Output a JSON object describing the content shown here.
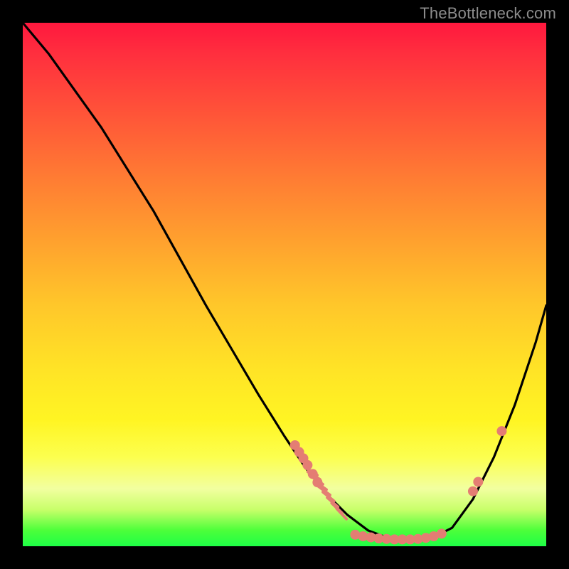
{
  "watermark": "TheBottleneck.com",
  "chart_data": {
    "type": "line",
    "title": "",
    "xlabel": "",
    "ylabel": "",
    "xlim": [
      0,
      100
    ],
    "ylim": [
      0,
      100
    ],
    "grid": false,
    "series": [
      {
        "name": "curve",
        "x": [
          0,
          5,
          10,
          15,
          20,
          25,
          30,
          35,
          40,
          45,
          50,
          54,
          58,
          62,
          66,
          70,
          74,
          78,
          82,
          86,
          90,
          94,
          98,
          100
        ],
        "y": [
          100,
          94,
          87,
          80,
          72,
          64,
          55,
          46,
          37.5,
          29,
          21,
          15,
          10,
          6,
          3,
          1.5,
          1,
          1.5,
          3.5,
          9,
          17,
          27,
          39,
          46
        ]
      }
    ],
    "markers": [
      {
        "kind": "dot",
        "x": 52.0,
        "y": 19.3
      },
      {
        "kind": "dot",
        "x": 52.8,
        "y": 18.0
      },
      {
        "kind": "dot",
        "x": 53.6,
        "y": 16.8
      },
      {
        "kind": "dot",
        "x": 54.4,
        "y": 15.5
      },
      {
        "kind": "dot",
        "x": 55.4,
        "y": 13.8
      },
      {
        "kind": "dot",
        "x": 56.3,
        "y": 12.2
      },
      {
        "kind": "dot",
        "x": 63.5,
        "y": 2.2
      },
      {
        "kind": "dot",
        "x": 65.0,
        "y": 1.9
      },
      {
        "kind": "dot",
        "x": 66.5,
        "y": 1.7
      },
      {
        "kind": "dot",
        "x": 68.0,
        "y": 1.5
      },
      {
        "kind": "dot",
        "x": 69.5,
        "y": 1.4
      },
      {
        "kind": "dot",
        "x": 71.0,
        "y": 1.3
      },
      {
        "kind": "dot",
        "x": 72.5,
        "y": 1.3
      },
      {
        "kind": "dot",
        "x": 74.0,
        "y": 1.3
      },
      {
        "kind": "dot",
        "x": 75.5,
        "y": 1.4
      },
      {
        "kind": "dot",
        "x": 77.0,
        "y": 1.6
      },
      {
        "kind": "dot",
        "x": 78.5,
        "y": 1.9
      },
      {
        "kind": "dot",
        "x": 80.0,
        "y": 2.4
      },
      {
        "kind": "dot",
        "x": 86.0,
        "y": 10.5
      },
      {
        "kind": "dot",
        "x": 87.0,
        "y": 12.3
      },
      {
        "kind": "dot",
        "x": 91.5,
        "y": 22.0
      },
      {
        "kind": "tick",
        "x": 55.1,
        "y": 14.3,
        "angle": -58
      },
      {
        "kind": "tick",
        "x": 55.6,
        "y": 13.5,
        "angle": -58
      },
      {
        "kind": "tick",
        "x": 56.2,
        "y": 12.6,
        "angle": -56
      },
      {
        "kind": "tick",
        "x": 56.9,
        "y": 11.6,
        "angle": -55
      },
      {
        "kind": "tick",
        "x": 57.6,
        "y": 10.6,
        "angle": -53
      },
      {
        "kind": "tick",
        "x": 58.4,
        "y": 9.5,
        "angle": -51
      },
      {
        "kind": "tick",
        "x": 59.2,
        "y": 8.4,
        "angle": -49
      },
      {
        "kind": "tick",
        "x": 60.0,
        "y": 7.3,
        "angle": -46
      },
      {
        "kind": "tick",
        "x": 60.9,
        "y": 6.2,
        "angle": -43
      }
    ],
    "marker_color": "#e47d73",
    "curve_color": "#000000"
  }
}
